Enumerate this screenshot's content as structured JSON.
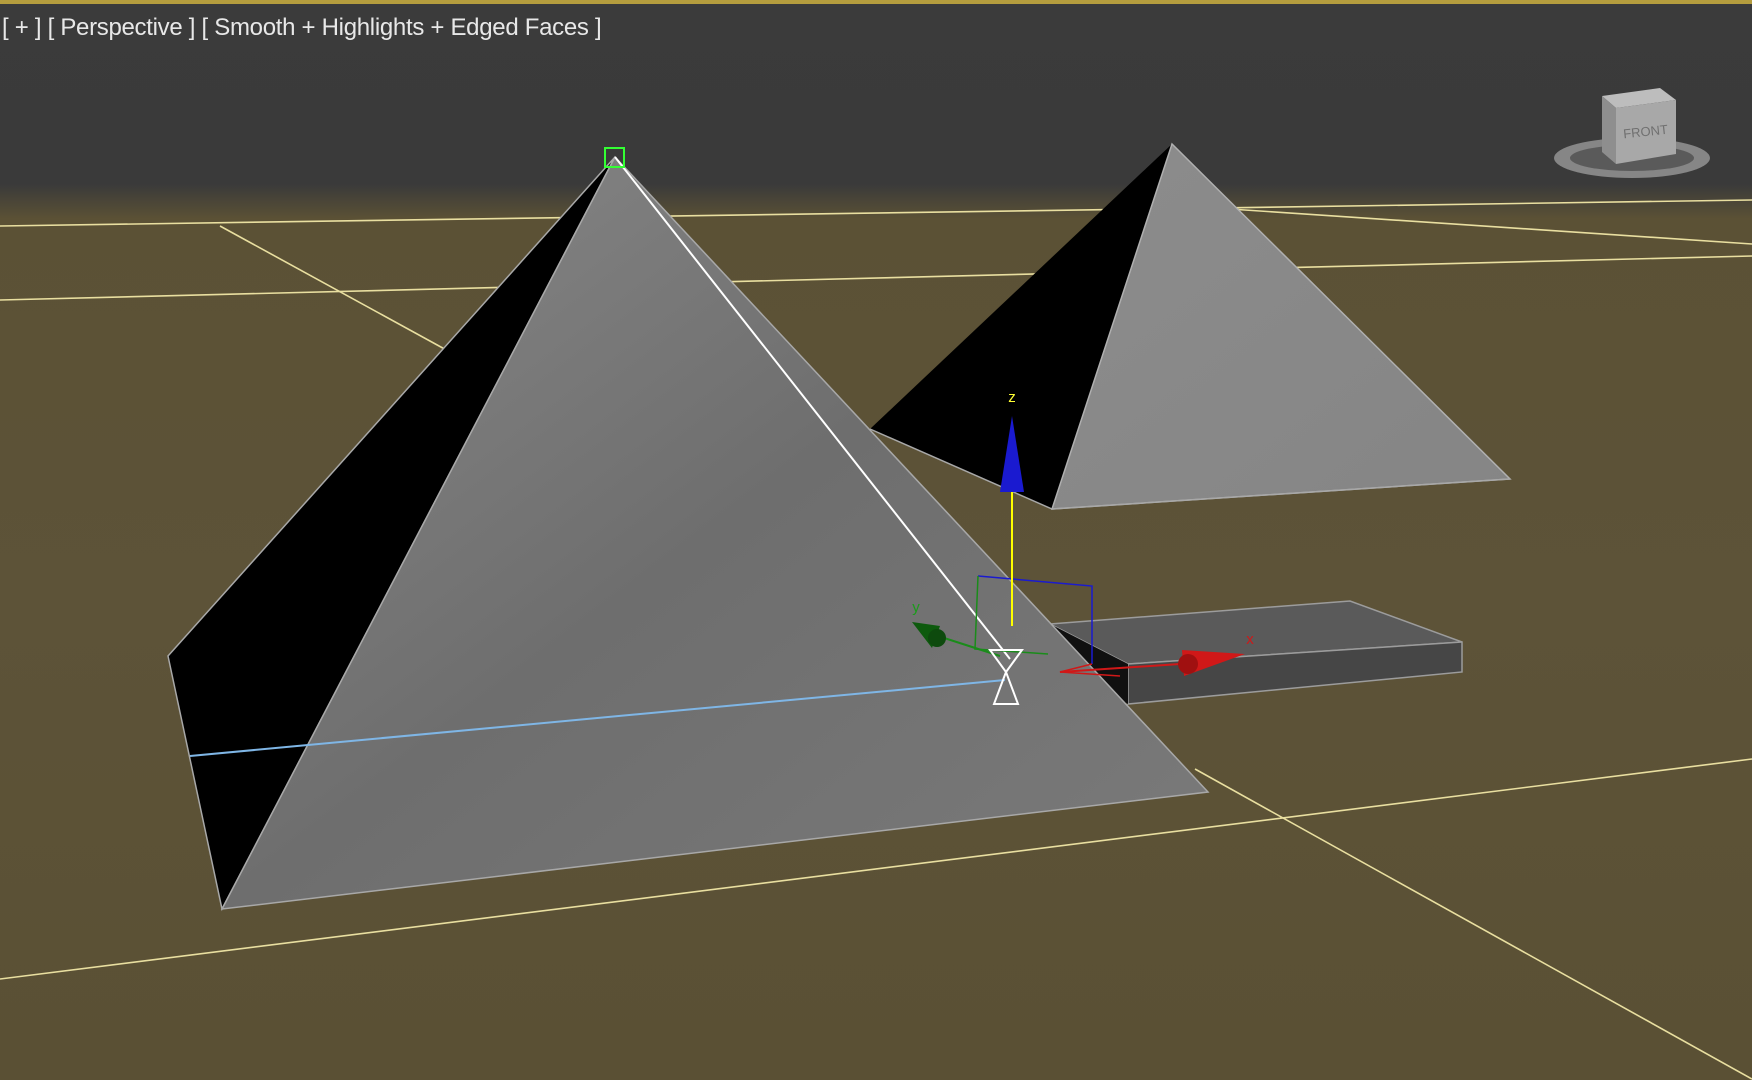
{
  "viewport": {
    "menu_plus": "[ + ]",
    "view_label": "[ Perspective ]",
    "shading_label": "[ Smooth + Highlights + Edged Faces ]"
  },
  "viewcube": {
    "face_label": "FRONT"
  },
  "gizmo": {
    "axis_x": "x",
    "axis_y": "y",
    "axis_z": "z"
  },
  "colors": {
    "viewport_top": "#3a3a3a",
    "ground": "#5d5338",
    "grid_line": "#e9dfa0",
    "selected_edge": "#7fb6e6",
    "axis_x": "#d01818",
    "axis_y": "#1a8c1a",
    "axis_z": "#1a1ad0",
    "axis_z_line": "#ffff00"
  }
}
